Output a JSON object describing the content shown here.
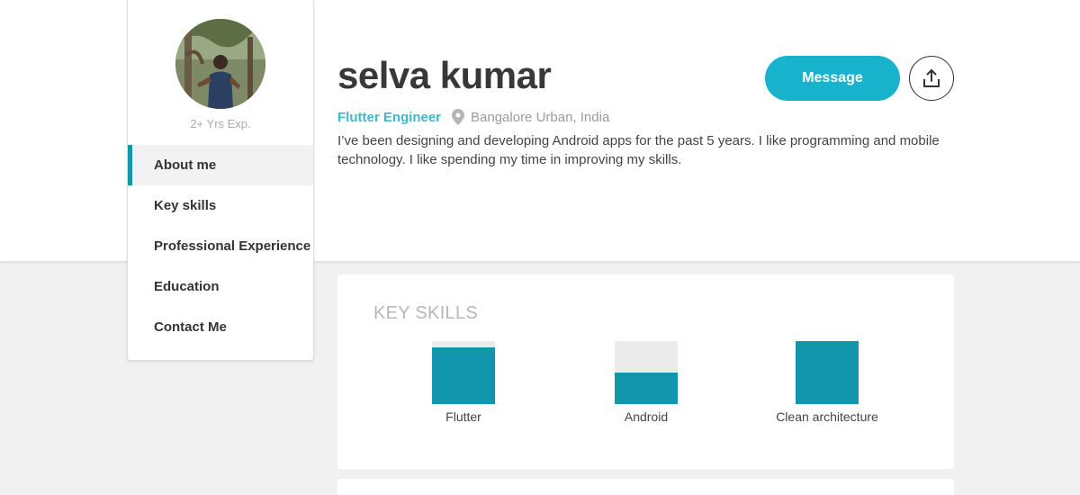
{
  "profile": {
    "name": "selva kumar",
    "role": "Flutter Engineer",
    "location": "Bangalore Urban, India",
    "experience": "2+ Yrs Exp.",
    "bio": "I’ve been designing and developing Android apps for the past 5 years. I like programming and mobile technology. I like spending my time in improving my skills."
  },
  "actions": {
    "message_label": "Message",
    "share_icon": "share-icon"
  },
  "sidebar": {
    "items": [
      {
        "label": "About me",
        "active": true
      },
      {
        "label": "Key skills",
        "active": false
      },
      {
        "label": "Professional Experience",
        "active": false
      },
      {
        "label": "Education",
        "active": false
      },
      {
        "label": "Contact Me",
        "active": false
      }
    ]
  },
  "key_skills": {
    "title": "KEY SKILLS",
    "skills": [
      {
        "label": "Flutter",
        "level": 0.9
      },
      {
        "label": "Android",
        "level": 0.5
      },
      {
        "label": "Clean architecture",
        "level": 1.0
      }
    ]
  },
  "colors": {
    "accent": "#17b3cc",
    "role_text": "#41b7cc",
    "bar_fill": "#1296ad",
    "bar_track": "#ebebeb",
    "active_marker": "#1396ad"
  }
}
